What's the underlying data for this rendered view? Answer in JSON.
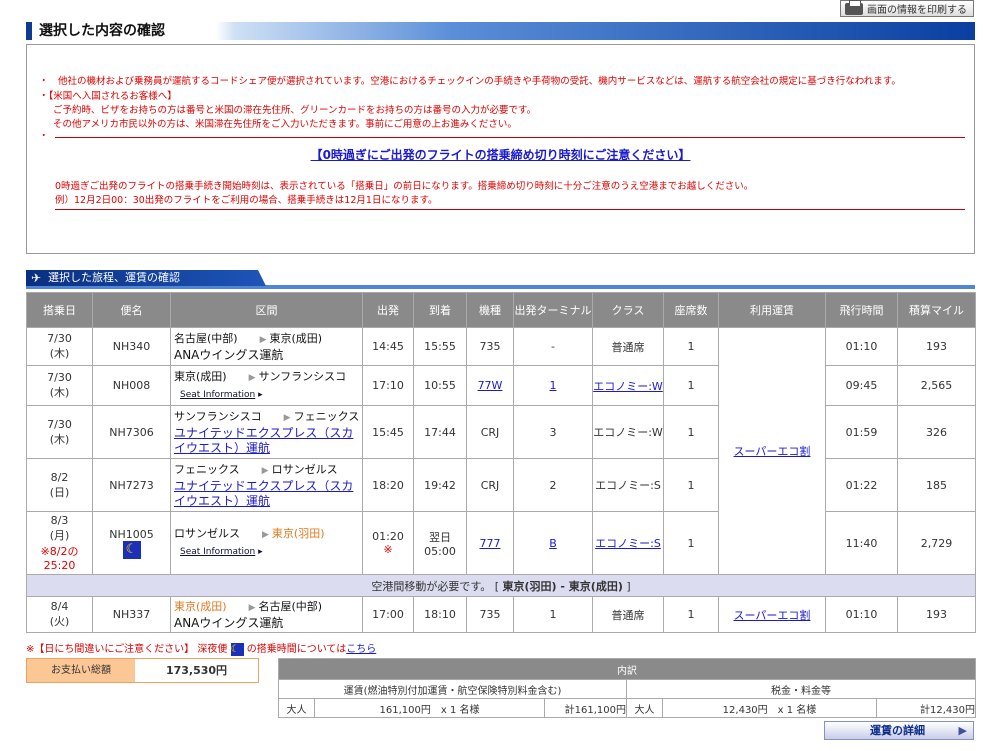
{
  "print_button": "画面の情報を印刷する",
  "section1_title": "選択した内容の確認",
  "notices": {
    "codeshare": "・　他社の機材および乗務員が運航するコードシェア便が選択されています。空港におけるチェックインの手続きや手荷物の受託、機内サービスなどは、運航する航空会社の規定に基づき行なわれます。",
    "us_title": "・【米国へ入国されるお客様へ】",
    "us_line1": "ご予約時、ビザをお持ちの方は番号と米国の滞在先住所、グリーンカードをお持ちの方は番号の入力が必要です。",
    "us_line2": "その他アメリカ市民以外の方は、米国滞在先住所をご入力いただきます。事前にご用意の上お進みください。",
    "midnight_link": "【0時過ぎにご出発のフライトの搭乗締め切り時刻にご注意ください】",
    "midnight_line1": "0時過ぎご出発のフライトの搭乗手続き開始時刻は、表示されている「搭乗日」の前日になります。搭乗締め切り時刻に十分ご注意のうえ空港までお越しください。",
    "midnight_line2": "例）12月2日00：30出発のフライトをご利用の場合、搭乗手続きは12月1日になります。"
  },
  "section2_title": "選択した旅程、運賃の確認",
  "headers": [
    "搭乗日",
    "便名",
    "区間",
    "出発",
    "到着",
    "機種",
    "出発ターミナル",
    "クラス",
    "座席数",
    "利用運賃",
    "飛行時間",
    "積算マイル"
  ],
  "flights": [
    {
      "date": "7/30",
      "dow": "(木)",
      "flight": "NH340",
      "from": "名古屋(中部)",
      "to": "東京(成田)",
      "op": "ANAウイングス運航",
      "dep": "14:45",
      "arr": "15:55",
      "eq": "735",
      "term": "-",
      "cls": "普通席",
      "seats": "1",
      "time": "01:10",
      "miles": "193"
    },
    {
      "date": "7/30",
      "dow": "(木)",
      "flight": "NH008",
      "from": "東京(成田)",
      "to": "サンフランシスコ",
      "seat_info": "Seat Information",
      "dep": "17:10",
      "arr": "10:55",
      "eq": "77W",
      "term": "1",
      "cls": "エコノミー:W",
      "seats": "1",
      "time": "09:45",
      "miles": "2,565"
    },
    {
      "date": "7/30",
      "dow": "(木)",
      "flight": "NH7306",
      "from": "サンフランシスコ",
      "to": "フェニックス",
      "op": "ユナイテッドエクスプレス（スカイウエスト）運航",
      "dep": "15:45",
      "arr": "17:44",
      "eq": "CRJ",
      "term": "3",
      "cls": "エコノミー:W",
      "seats": "1",
      "time": "01:59",
      "miles": "326"
    },
    {
      "date": "8/2",
      "dow": "(日)",
      "flight": "NH7273",
      "from": "フェニックス",
      "to": "ロサンゼルス",
      "op": "ユナイテッドエクスプレス（スカイウエスト）運航",
      "dep": "18:20",
      "arr": "19:42",
      "eq": "CRJ",
      "term": "2",
      "cls": "エコノミー:S",
      "seats": "1",
      "time": "01:22",
      "miles": "185"
    },
    {
      "date": "8/3",
      "dow": "(月)",
      "note": "※8/2の 25:20",
      "flight": "NH1005",
      "from": "ロサンゼルス",
      "to": "東京(羽田)",
      "seat_info": "Seat Information",
      "dep": "01:20",
      "dep_mark": "※",
      "arr_pre": "翌日",
      "arr": "05:00",
      "eq": "777",
      "term": "B",
      "cls": "エコノミー:S",
      "seats": "1",
      "time": "11:40",
      "miles": "2,729"
    },
    {
      "date": "8/4",
      "dow": "(火)",
      "flight": "NH337",
      "from": "東京(成田)",
      "to": "名古屋(中部)",
      "op": "ANAウイングス運航",
      "dep": "17:00",
      "arr": "18:10",
      "eq": "735",
      "term": "1",
      "cls": "普通席",
      "seats": "1",
      "fare": "スーパーエコ割",
      "time": "01:10",
      "miles": "193"
    }
  ],
  "fare_main": "スーパーエコ割",
  "transfer": {
    "text": "空港間移動が必要です。 [ ",
    "route": "東京(羽田) - 東京(成田)",
    "close": " ]"
  },
  "footnote": {
    "text": "※【日にち間違いにご注意ください】 深夜便 ",
    "text2": " の搭乗時間については",
    "link": "こちら"
  },
  "total": {
    "label": "お支払い総額",
    "value": "173,530円"
  },
  "breakdown": {
    "title": "内訳",
    "fare_head": "運賃(燃油特別付加運賃・航空保険特別料金含む)",
    "tax_head": "税金・料金等",
    "fare": {
      "type": "大人",
      "unit": "161,100円　x 1 名様",
      "sum": "計161,100円"
    },
    "tax": {
      "type": "大人",
      "unit": "12,430円　x 1 名様",
      "sum": "計12,430円"
    }
  },
  "detail_button": "運賃の詳細"
}
